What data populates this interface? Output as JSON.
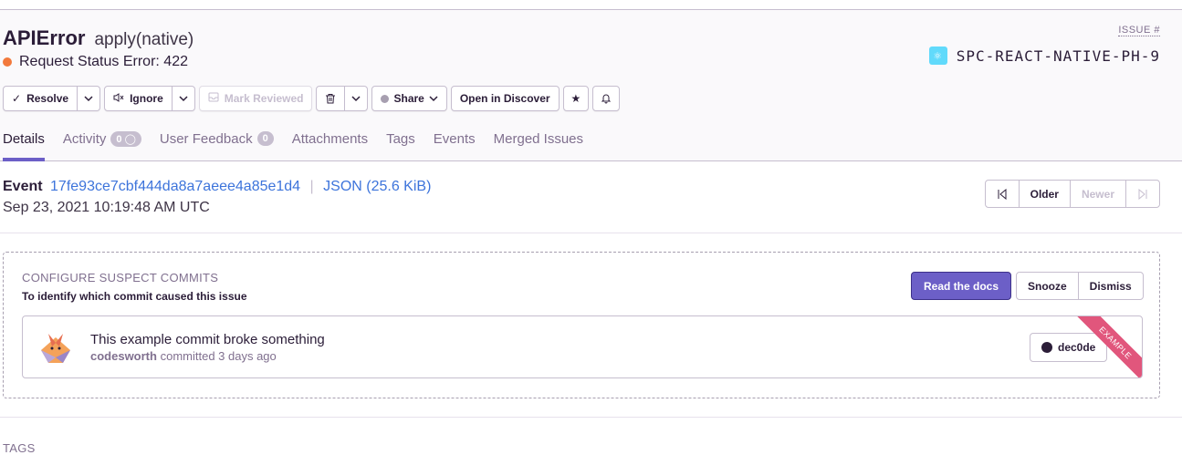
{
  "issue": {
    "title": "APIError",
    "culprit": "apply(native)",
    "status_text": "Request Status Error: 422",
    "status_color": "#f2793c",
    "issue_label": "ISSUE #",
    "short_id": "SPC-REACT-NATIVE-PH-9",
    "platform_icon": "react-icon"
  },
  "actions": {
    "resolve": "Resolve",
    "ignore": "Ignore",
    "mark_reviewed": "Mark Reviewed",
    "share": "Share",
    "open_in_discover": "Open in Discover"
  },
  "tabs": [
    {
      "label": "Details",
      "active": true
    },
    {
      "label": "Activity",
      "badge": "0"
    },
    {
      "label": "User Feedback",
      "badge": "0"
    },
    {
      "label": "Attachments"
    },
    {
      "label": "Tags"
    },
    {
      "label": "Events"
    },
    {
      "label": "Merged Issues"
    }
  ],
  "event": {
    "label": "Event",
    "id": "17fe93ce7cbf444da8a7aeee4a85e1d4",
    "json_link": "JSON (25.6 KiB)",
    "date": "Sep 23, 2021 10:19:48 AM UTC",
    "older": "Older",
    "newer": "Newer"
  },
  "suspect": {
    "title": "CONFIGURE SUSPECT COMMITS",
    "subtitle": "To identify which commit caused this issue",
    "read_docs": "Read the docs",
    "snooze": "Snooze",
    "dismiss": "Dismiss",
    "commit": {
      "message": "This example commit broke something",
      "author": "codesworth",
      "meta": "committed 3 days ago",
      "sha": "dec0de",
      "ribbon": "EXAMPLE"
    }
  },
  "tags_section": {
    "title": "TAGS"
  }
}
